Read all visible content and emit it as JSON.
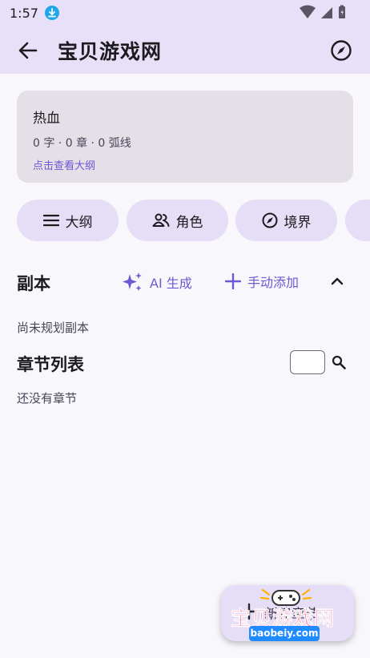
{
  "status_bar": {
    "time": "1:57"
  },
  "app_bar": {
    "title": "宝贝游戏网"
  },
  "book": {
    "title": "热血",
    "stats": "0 字 · 0 章 · 0 弧线",
    "outline_link": "点击查看大纲"
  },
  "chips": [
    {
      "label": "大纲",
      "icon": "menu-icon"
    },
    {
      "label": "角色",
      "icon": "people-icon"
    },
    {
      "label": "境界",
      "icon": "compass-icon"
    }
  ],
  "instances": {
    "title": "副本",
    "ai_generate": "AI 生成",
    "manual_add": "手动添加",
    "empty_text": "尚未规划副本"
  },
  "chapters": {
    "title": "章节列表",
    "empty_text": "还没有章节"
  },
  "fab": {
    "label": "新建章节"
  },
  "watermark": {
    "title": "宝贝游戏网",
    "domain": "baobeiy.com"
  },
  "colors": {
    "accent": "#6E57D2",
    "app_bar": "#E8E0F8",
    "chip": "#E6DDF6",
    "card": "#E5DFE8",
    "watermark": "#FF1F6A"
  }
}
